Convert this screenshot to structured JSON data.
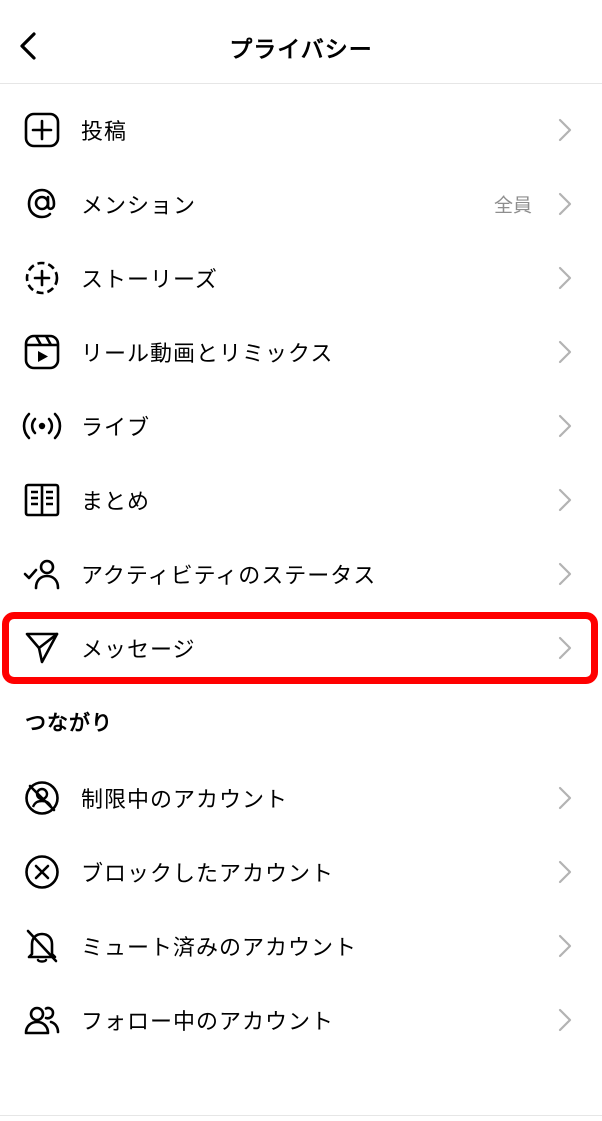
{
  "header": {
    "title": "プライバシー"
  },
  "items": [
    {
      "label": "投稿",
      "value": "",
      "icon": "plus-square-icon"
    },
    {
      "label": "メンション",
      "value": "全員",
      "icon": "at-icon"
    },
    {
      "label": "ストーリーズ",
      "value": "",
      "icon": "story-add-icon"
    },
    {
      "label": "リール動画とリミックス",
      "value": "",
      "icon": "reels-icon"
    },
    {
      "label": "ライブ",
      "value": "",
      "icon": "live-icon"
    },
    {
      "label": "まとめ",
      "value": "",
      "icon": "guides-icon"
    },
    {
      "label": "アクティビティのステータス",
      "value": "",
      "icon": "activity-status-icon"
    },
    {
      "label": "メッセージ",
      "value": "",
      "icon": "paper-plane-icon"
    }
  ],
  "connections": {
    "title": "つながり",
    "items": [
      {
        "label": "制限中のアカウント",
        "icon": "restricted-icon"
      },
      {
        "label": "ブロックしたアカウント",
        "icon": "blocked-icon"
      },
      {
        "label": "ミュート済みのアカウント",
        "icon": "muted-bell-icon"
      },
      {
        "label": "フォロー中のアカウント",
        "icon": "following-icon"
      }
    ]
  },
  "colors": {
    "highlight": "#ff0000",
    "secondary_text": "#8e8e8e",
    "chevron": "#b3b3b3"
  }
}
